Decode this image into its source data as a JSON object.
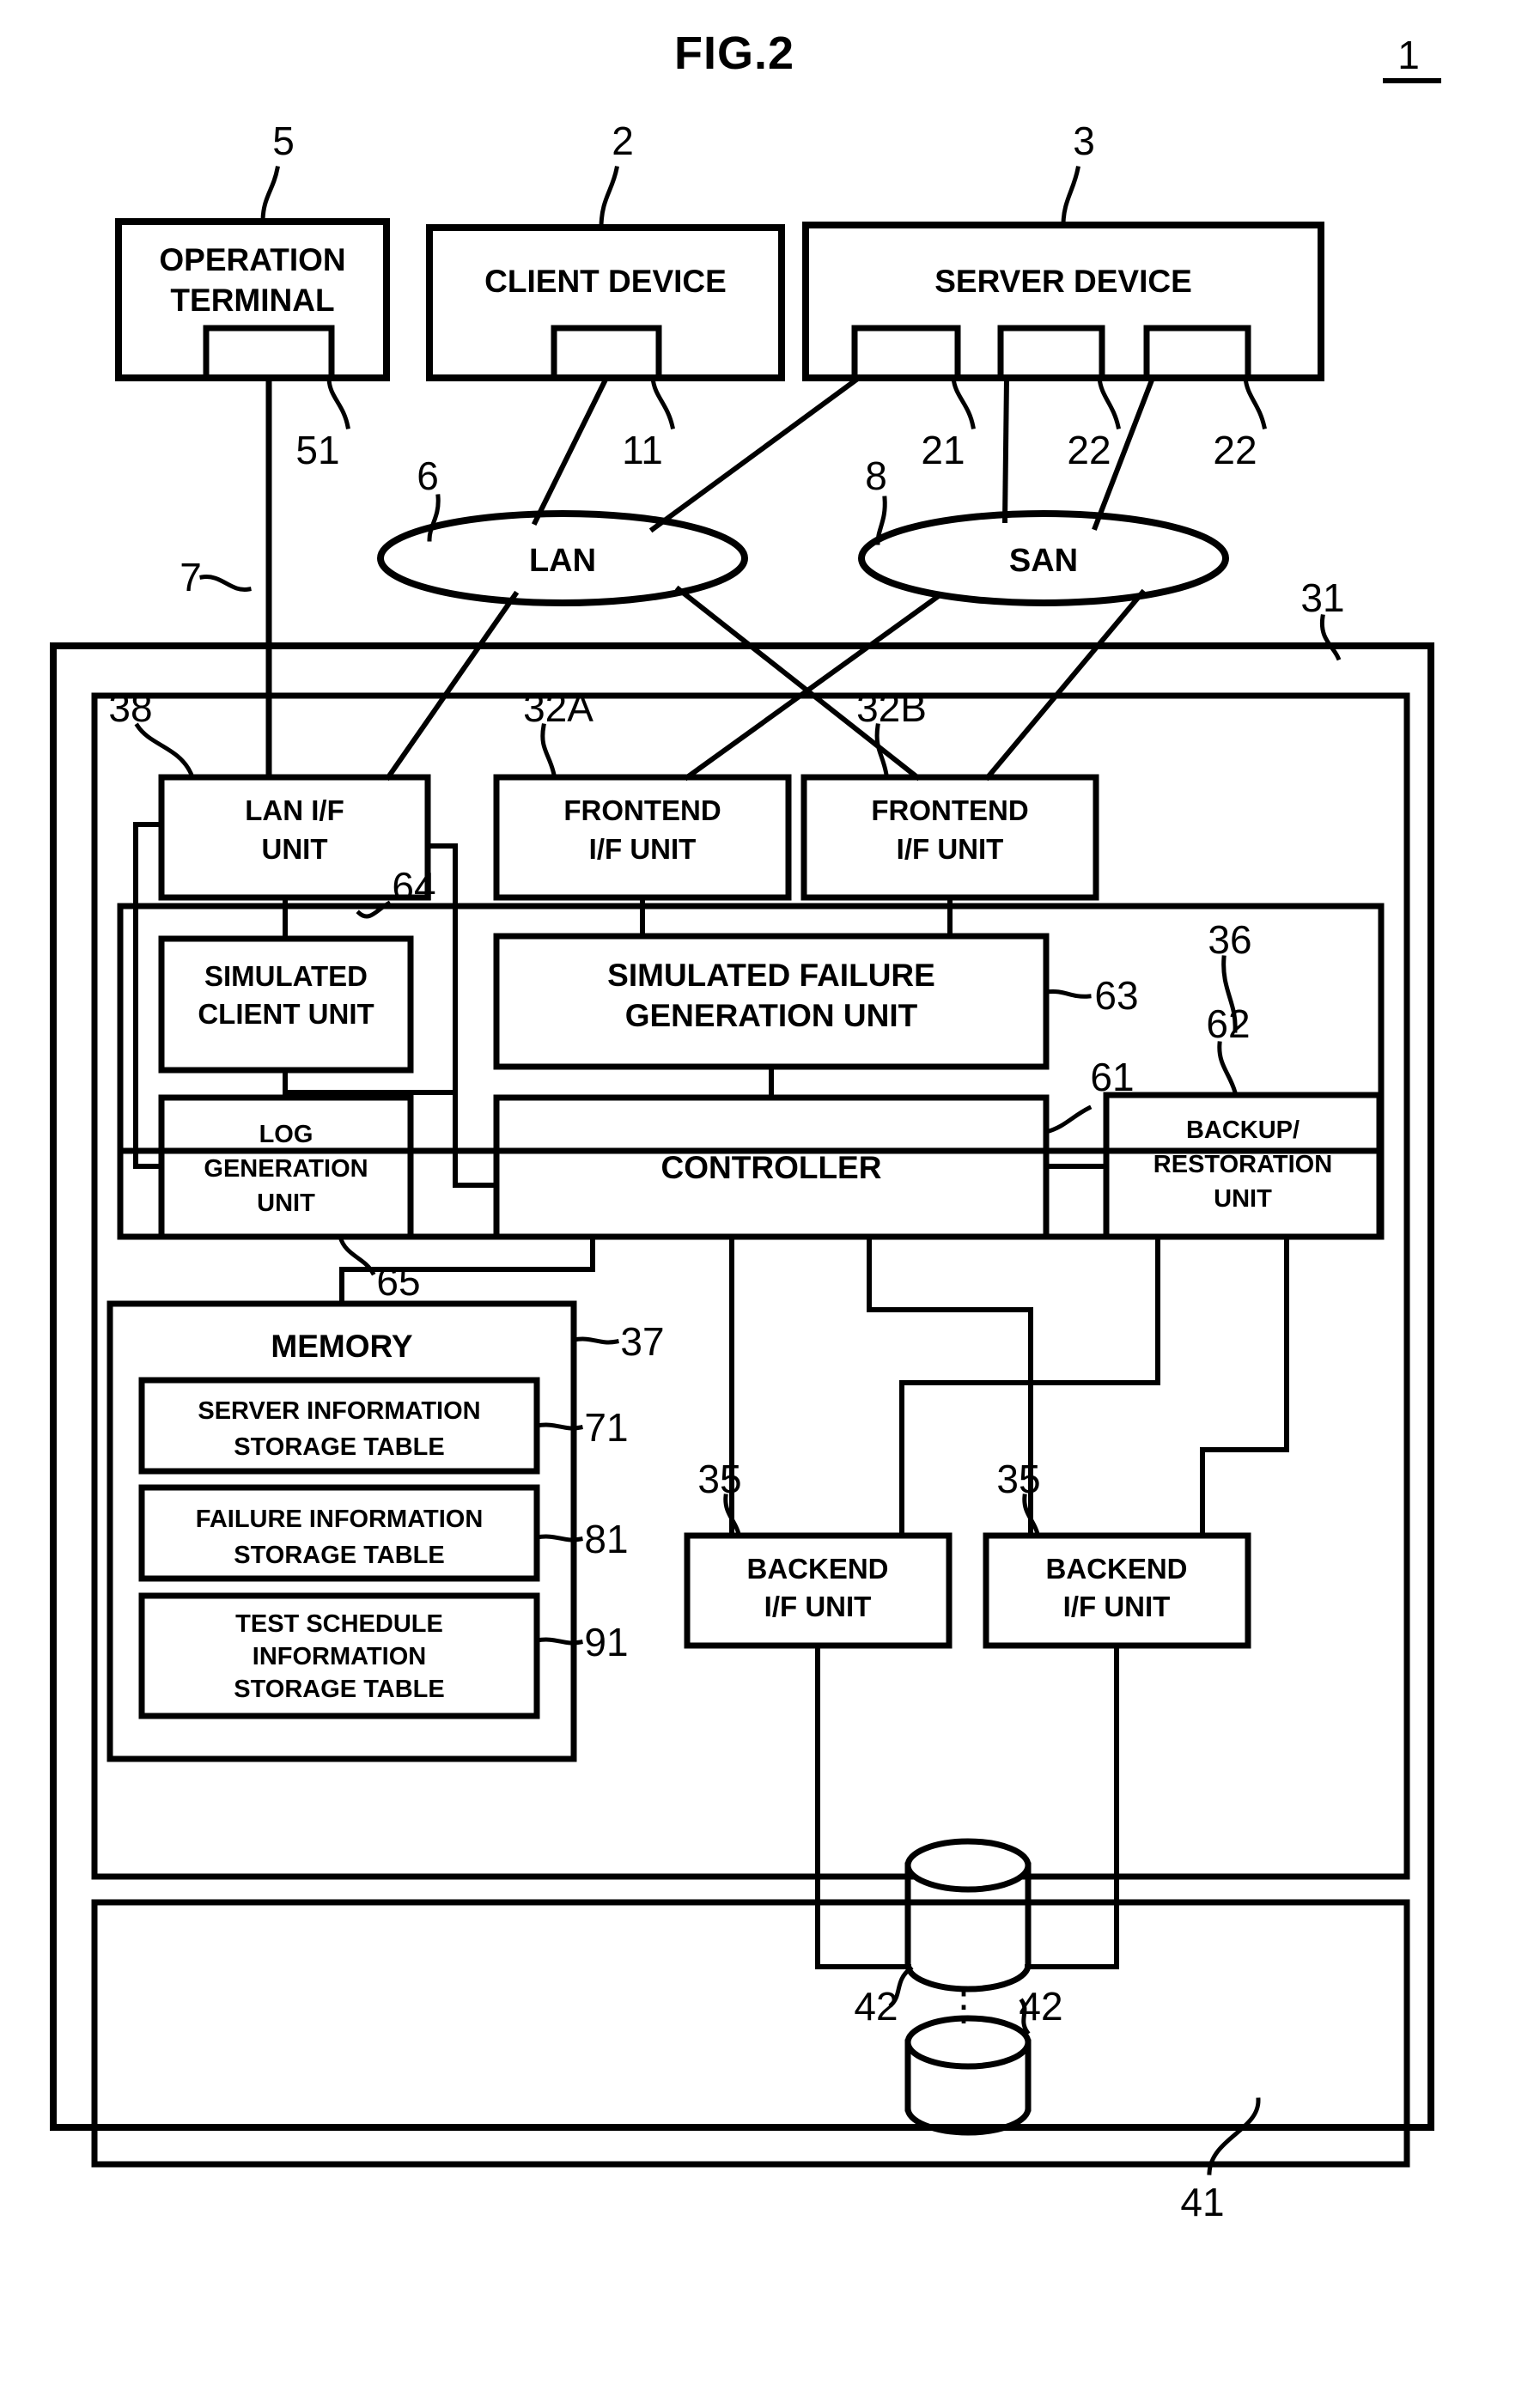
{
  "figure": {
    "title": "FIG.2",
    "system_ref": "1"
  },
  "top_devices": [
    {
      "label_line1": "OPERATION",
      "label_line2": "TERMINAL",
      "ref": "5",
      "port_ref": "51"
    },
    {
      "label_line1": "CLIENT DEVICE",
      "label_line2": "",
      "ref": "2",
      "port_ref": "11"
    },
    {
      "label_line1": "SERVER DEVICE",
      "label_line2": "",
      "ref": "3",
      "port_refs": [
        "21",
        "22",
        "22"
      ]
    }
  ],
  "networks": [
    {
      "name": "LAN",
      "ref": "6"
    },
    {
      "name": "SAN",
      "ref": "8"
    }
  ],
  "links": {
    "operation_terminal_link_ref": "7"
  },
  "storage_system": {
    "outer_ref": "31",
    "controller_block_ref": "36",
    "disk_enclosure_ref": "41",
    "interfaces": [
      {
        "label_line1": "LAN I/F",
        "label_line2": "UNIT",
        "ref": "38"
      },
      {
        "label_line1": "FRONTEND",
        "label_line2": "I/F UNIT",
        "ref": "32A"
      },
      {
        "label_line1": "FRONTEND",
        "label_line2": "I/F UNIT",
        "ref": "32B"
      }
    ],
    "units": [
      {
        "label_line1": "SIMULATED",
        "label_line2": "CLIENT UNIT",
        "ref": "64"
      },
      {
        "label_line1": "SIMULATED FAILURE",
        "label_line2": "GENERATION UNIT",
        "ref": "63"
      },
      {
        "label_line1": "LOG",
        "label_line2": "GENERATION",
        "label_line3": "UNIT",
        "ref": "65"
      },
      {
        "label_line1": "CONTROLLER",
        "label_line2": "",
        "ref": "61"
      },
      {
        "label_line1": "BACKUP/",
        "label_line2": "RESTORATION",
        "label_line3": "UNIT",
        "ref": "62"
      }
    ],
    "memory": {
      "title": "MEMORY",
      "ref": "37",
      "tables": [
        {
          "line1": "SERVER INFORMATION",
          "line2": "STORAGE TABLE",
          "ref": "71"
        },
        {
          "line1": "FAILURE INFORMATION",
          "line2": "STORAGE TABLE",
          "ref": "81"
        },
        {
          "line1": "TEST SCHEDULE",
          "line2": "INFORMATION",
          "line3": "STORAGE TABLE",
          "ref": "91"
        }
      ]
    },
    "backend_interfaces": [
      {
        "label_line1": "BACKEND",
        "label_line2": "I/F UNIT",
        "ref": "35"
      },
      {
        "label_line1": "BACKEND",
        "label_line2": "I/F UNIT",
        "ref": "35"
      }
    ],
    "disks": [
      {
        "ref": "42"
      },
      {
        "ref": "42"
      }
    ],
    "disk_ellipsis": "⋮"
  }
}
